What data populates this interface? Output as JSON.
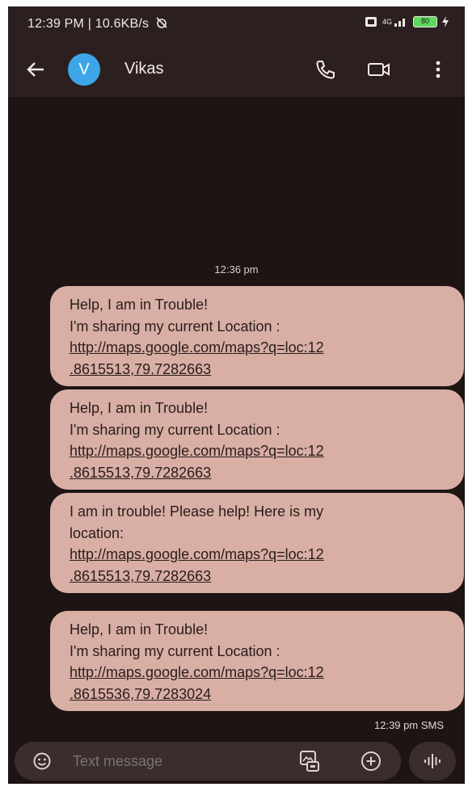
{
  "status_bar": {
    "time_and_speed": "12:39 PM | 10.6KB/s",
    "network": "4G",
    "battery": "80"
  },
  "header": {
    "avatar_letter": "V",
    "contact_name": "Vikas",
    "icons": [
      "back-arrow-icon",
      "phone-icon",
      "video-icon",
      "more-vertical-icon"
    ]
  },
  "conversation": {
    "timestamp": "12:36 pm",
    "messages": [
      {
        "line1": "Help, I am in Trouble!",
        "line2": "I'm sharing my current Location :",
        "link_line1": "http://maps.google.com/maps?q=loc:12",
        "link_line2": ".8615513,79.7282663"
      },
      {
        "line1": "Help, I am in Trouble!",
        "line2": "I'm sharing my current Location :",
        "link_line1": "http://maps.google.com/maps?q=loc:12",
        "link_line2": ".8615513,79.7282663"
      },
      {
        "line1": "I am in trouble! Please help! Here is my",
        "line2": "location:",
        "link_line1": "http://maps.google.com/maps?q=loc:12",
        "link_line2": ".8615513,79.7282663"
      },
      {
        "line1": "Help, I am in Trouble!",
        "line2": "I'm sharing my current Location :",
        "link_line1": "http://maps.google.com/maps?q=loc:12",
        "link_line2": ".8615536,79.7283024"
      }
    ],
    "last_meta": "12:39 pm SMS"
  },
  "composer": {
    "placeholder": "Text message",
    "icons": [
      "emoji-icon",
      "gallery-icon",
      "add-icon",
      "voice-icon"
    ]
  },
  "colors": {
    "background": "#1e1413",
    "bars": "#2b201f",
    "bubble": "#d8aea5",
    "avatar": "#3da6e8",
    "composer": "#3b2d2b"
  }
}
